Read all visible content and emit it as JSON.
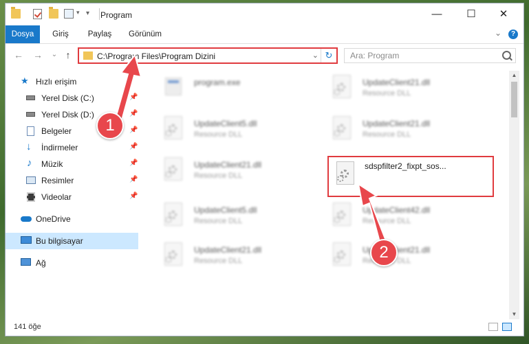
{
  "window": {
    "title": "Program",
    "caption": {
      "minimize": "—",
      "maximize": "☐",
      "close": "✕"
    }
  },
  "ribbon": {
    "tabs": [
      {
        "label": "Dosya",
        "active": true
      },
      {
        "label": "Giriş"
      },
      {
        "label": "Paylaş"
      },
      {
        "label": "Görünüm"
      }
    ],
    "help_label": "?",
    "expand_icon": "chevron-down-icon"
  },
  "nav": {
    "back": "←",
    "forward": "→",
    "recent": "⌄",
    "up": "↑",
    "address": "C:\\Program Files\\Program Dizini",
    "address_dropdown": "⌄",
    "refresh": "↻",
    "search_placeholder": "Ara: Program"
  },
  "sidebar": {
    "items": [
      {
        "label": "Hızlı erişim",
        "icon": "star-icon"
      },
      {
        "label": "Yerel Disk (C:)",
        "icon": "drive-icon",
        "pinned": true
      },
      {
        "label": "Yerel Disk (D:)",
        "icon": "drive-icon",
        "pinned": true
      },
      {
        "label": "Belgeler",
        "icon": "documents-icon",
        "pinned": true
      },
      {
        "label": "İndirmeler",
        "icon": "download-icon",
        "pinned": true
      },
      {
        "label": "Müzik",
        "icon": "music-icon",
        "pinned": true
      },
      {
        "label": "Resimler",
        "icon": "pictures-icon",
        "pinned": true
      },
      {
        "label": "Videolar",
        "icon": "videos-icon",
        "pinned": true
      },
      {
        "label": "OneDrive",
        "icon": "cloud-icon"
      },
      {
        "label": "Bu bilgisayar",
        "icon": "computer-icon",
        "selected": true
      },
      {
        "label": "Ağ",
        "icon": "network-icon"
      }
    ],
    "pin_glyph": "📌"
  },
  "files": [
    {
      "name": "program.exe",
      "type": "",
      "kind": "exe"
    },
    {
      "name": "UpdateClient21.dll",
      "type": "Resource DLL",
      "kind": "dll"
    },
    {
      "name": "UpdateClient5.dll",
      "type": "Resource DLL",
      "kind": "dll"
    },
    {
      "name": "UpdateClient21.dll",
      "type": "Resource DLL",
      "kind": "dll"
    },
    {
      "name": "UpdateClient21.dll",
      "type": "Resource DLL",
      "kind": "dll"
    },
    {
      "name": "sdspfilter2_fixpt_sos...",
      "type": "",
      "kind": "dll",
      "highlighted": true
    },
    {
      "name": "UpdateClient5.dll",
      "type": "Resource DLL",
      "kind": "dll"
    },
    {
      "name": "UpdateClient42.dll",
      "type": "Resource DLL",
      "kind": "dll"
    },
    {
      "name": "UpdateClient21.dll",
      "type": "Resource DLL",
      "kind": "dll"
    },
    {
      "name": "UpdateClient21.dll",
      "type": "Resource DLL",
      "kind": "dll"
    }
  ],
  "status": {
    "count": "141 öğe"
  },
  "annotations": {
    "step1": "1",
    "step2": "2",
    "accent": "#e8474c"
  },
  "colors": {
    "accent": "#1979ca",
    "highlight": "#e03a3e",
    "selection": "#cce8ff"
  }
}
